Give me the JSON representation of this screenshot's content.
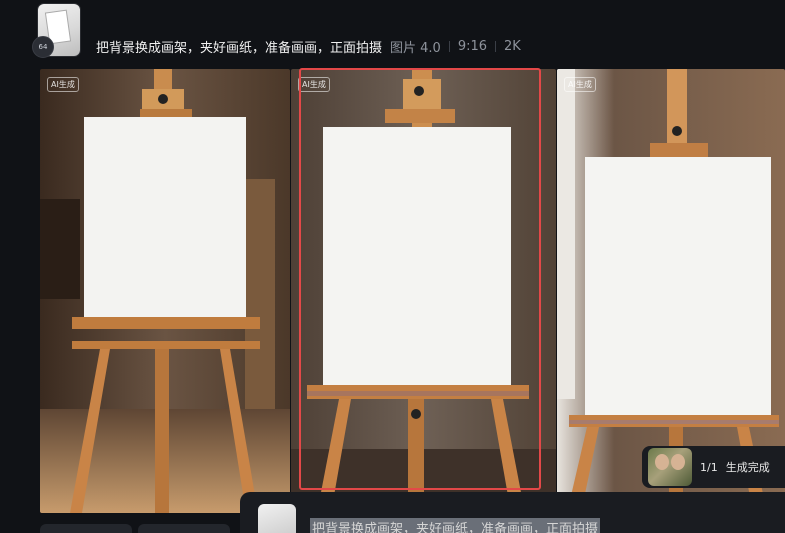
{
  "header": {
    "avatar_badge": "64",
    "prompt": "把背景换成画架，夹好画纸，准备画画，正面拍摄",
    "model": "图片 4.0",
    "ratio": "9:16",
    "resolution": "2K"
  },
  "images": [
    {
      "ai_tag": "AI生成"
    },
    {
      "ai_tag": "AI生成"
    },
    {
      "ai_tag": "AI生成"
    }
  ],
  "toast": {
    "count": "1/1",
    "status": "生成完成"
  },
  "bottom": {
    "prompt_echo": "把背景换成画架，夹好画纸，准备画画，正面拍摄"
  }
}
